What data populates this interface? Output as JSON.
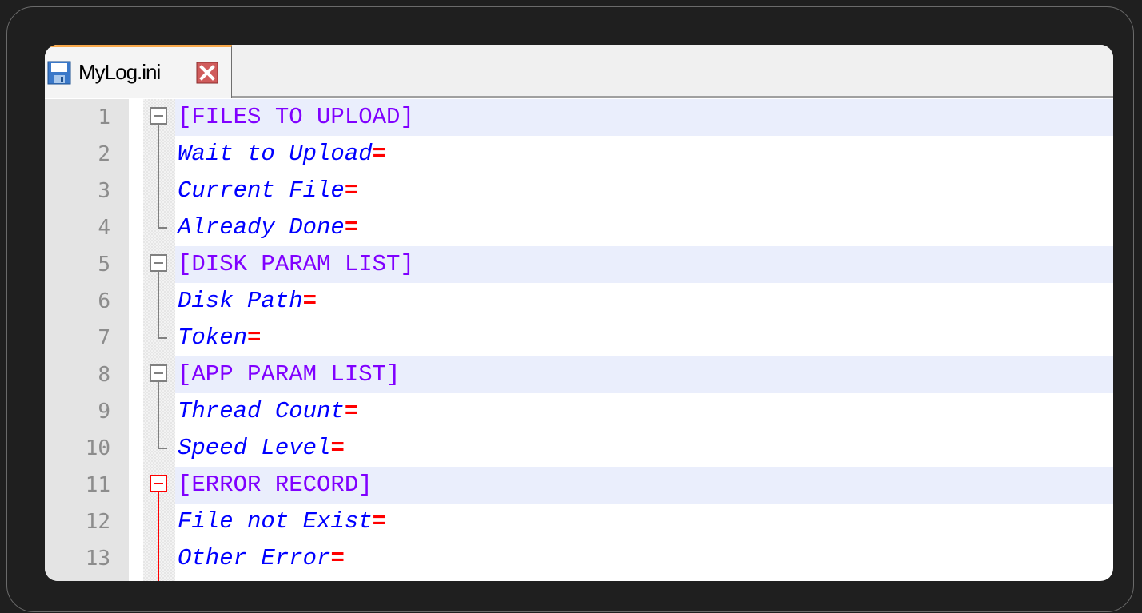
{
  "tab": {
    "filename": "MyLog.ini"
  },
  "lines": [
    {
      "num": "1",
      "type": "section",
      "header": "[FILES TO UPLOAD]"
    },
    {
      "num": "2",
      "type": "key",
      "key": "Wait to Upload",
      "eq": "="
    },
    {
      "num": "3",
      "type": "key",
      "key": "Current File",
      "eq": "="
    },
    {
      "num": "4",
      "type": "key",
      "key": "Already Done",
      "eq": "="
    },
    {
      "num": "5",
      "type": "section",
      "header": "[DISK PARAM LIST]"
    },
    {
      "num": "6",
      "type": "key",
      "key": "Disk Path",
      "eq": "="
    },
    {
      "num": "7",
      "type": "key",
      "key": "Token",
      "eq": "="
    },
    {
      "num": "8",
      "type": "section",
      "header": "[APP PARAM LIST]"
    },
    {
      "num": "9",
      "type": "key",
      "key": "Thread Count",
      "eq": "="
    },
    {
      "num": "10",
      "type": "key",
      "key": "Speed Level",
      "eq": "="
    },
    {
      "num": "11",
      "type": "section",
      "header": "[ERROR RECORD]",
      "active": true
    },
    {
      "num": "12",
      "type": "key",
      "key": "File not Exist",
      "eq": "="
    },
    {
      "num": "13",
      "type": "key",
      "key": "Other Error",
      "eq": "="
    }
  ],
  "colors": {
    "section_header": "#8000ff",
    "key": "#0000ff",
    "equals": "#ff0000",
    "active_fold": "#ff0000",
    "tab_accent": "#f9a94b"
  },
  "icons": {
    "tab_file": "save-icon",
    "tab_close": "close-icon"
  }
}
